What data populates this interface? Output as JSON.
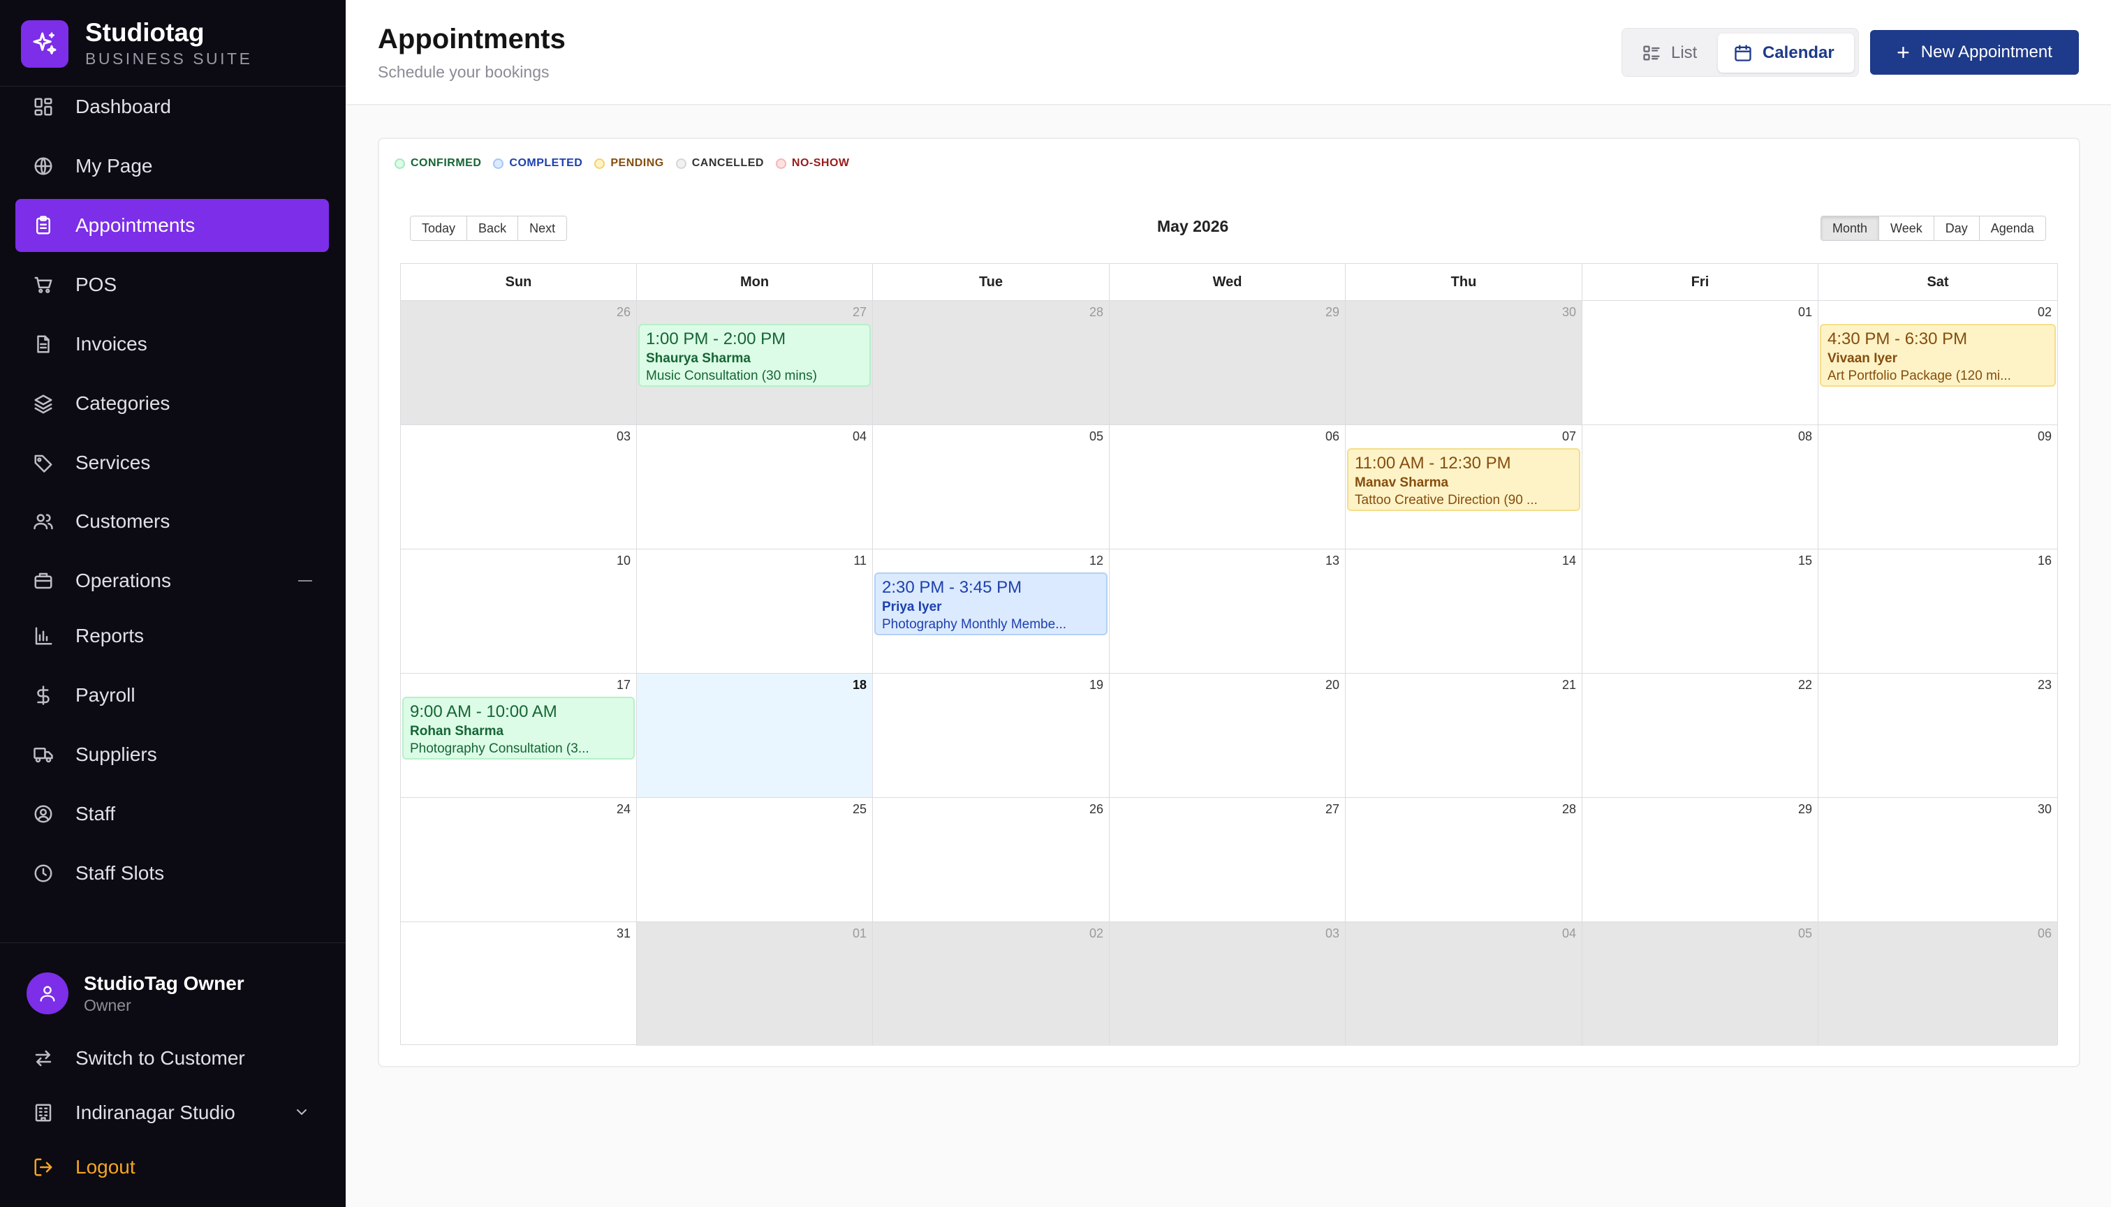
{
  "brand": {
    "name": "Studiotag",
    "subtitle": "BUSINESS SUITE"
  },
  "nav": [
    {
      "label": "Dashboard",
      "icon": "dashboard-icon"
    },
    {
      "label": "My Page",
      "icon": "globe-icon"
    },
    {
      "label": "Appointments",
      "icon": "clipboard-icon",
      "active": true
    },
    {
      "label": "POS",
      "icon": "cart-icon"
    },
    {
      "label": "Invoices",
      "icon": "document-icon"
    },
    {
      "label": "Categories",
      "icon": "layers-icon"
    },
    {
      "label": "Services",
      "icon": "tag-icon"
    },
    {
      "label": "Customers",
      "icon": "users-icon"
    },
    {
      "label": "Operations",
      "icon": "briefcase-icon",
      "expanded": true
    },
    {
      "label": "Reports",
      "icon": "bar-chart-icon"
    },
    {
      "label": "Payroll",
      "icon": "dollar-icon"
    },
    {
      "label": "Suppliers",
      "icon": "truck-icon"
    },
    {
      "label": "Staff",
      "icon": "user-circle-icon"
    },
    {
      "label": "Staff Slots",
      "icon": "clock-icon"
    }
  ],
  "user": {
    "name": "StudioTag Owner",
    "role": "Owner"
  },
  "bottom": {
    "switch_label": "Switch to Customer",
    "studio_label": "Indiranagar Studio",
    "logout_label": "Logout"
  },
  "header": {
    "title": "Appointments",
    "subtitle": "Schedule your bookings",
    "view_list": "List",
    "view_calendar": "Calendar",
    "active_view": "Calendar",
    "new_button": "New Appointment"
  },
  "legend": [
    {
      "label": "CONFIRMED",
      "color": "#166534",
      "dot_fill": "#dcfce7",
      "dot_border": "#a7e8bf"
    },
    {
      "label": "COMPLETED",
      "color": "#1e40af",
      "dot_fill": "#dbeafe",
      "dot_border": "#a8c6f2"
    },
    {
      "label": "PENDING",
      "color": "#854d0e",
      "dot_fill": "#fef3c7",
      "dot_border": "#f2d36e"
    },
    {
      "label": "CANCELLED",
      "color": "#333333",
      "dot_fill": "#f1f1f1",
      "dot_border": "#d6d6d6"
    },
    {
      "label": "NO-SHOW",
      "color": "#991b1b",
      "dot_fill": "#fde2e2",
      "dot_border": "#f3b6b6"
    }
  ],
  "calendar": {
    "nav_buttons": [
      "Today",
      "Back",
      "Next"
    ],
    "month_label": "May 2026",
    "range_buttons": [
      "Month",
      "Week",
      "Day",
      "Agenda"
    ],
    "active_range": "Month",
    "weekdays": [
      "Sun",
      "Mon",
      "Tue",
      "Wed",
      "Thu",
      "Fri",
      "Sat"
    ],
    "weeks": [
      [
        {
          "d": "26",
          "off": true
        },
        {
          "d": "27",
          "off": true
        },
        {
          "d": "28",
          "off": true
        },
        {
          "d": "29",
          "off": true
        },
        {
          "d": "30",
          "off": true
        },
        {
          "d": "01"
        },
        {
          "d": "02"
        }
      ],
      [
        {
          "d": "03"
        },
        {
          "d": "04"
        },
        {
          "d": "05"
        },
        {
          "d": "06"
        },
        {
          "d": "07"
        },
        {
          "d": "08"
        },
        {
          "d": "09"
        }
      ],
      [
        {
          "d": "10"
        },
        {
          "d": "11"
        },
        {
          "d": "12"
        },
        {
          "d": "13"
        },
        {
          "d": "14"
        },
        {
          "d": "15"
        },
        {
          "d": "16"
        }
      ],
      [
        {
          "d": "17"
        },
        {
          "d": "18",
          "today": true
        },
        {
          "d": "19"
        },
        {
          "d": "20"
        },
        {
          "d": "21"
        },
        {
          "d": "22"
        },
        {
          "d": "23"
        }
      ],
      [
        {
          "d": "24"
        },
        {
          "d": "25"
        },
        {
          "d": "26"
        },
        {
          "d": "27"
        },
        {
          "d": "28"
        },
        {
          "d": "29"
        },
        {
          "d": "30"
        }
      ],
      [
        {
          "d": "31"
        },
        {
          "d": "01",
          "off": true
        },
        {
          "d": "02",
          "off": true
        },
        {
          "d": "03",
          "off": true
        },
        {
          "d": "04",
          "off": true
        },
        {
          "d": "05",
          "off": true
        },
        {
          "d": "06",
          "off": true
        }
      ]
    ],
    "events": [
      {
        "week": 0,
        "day": 1,
        "status": "confirmed",
        "time": "1:00 PM - 2:00 PM",
        "customer": "Shaurya Sharma",
        "service": "Music Consultation (30 mins)"
      },
      {
        "week": 0,
        "day": 6,
        "status": "pending",
        "time": "4:30 PM - 6:30 PM",
        "customer": "Vivaan Iyer",
        "service": "Art Portfolio Package (120 mi..."
      },
      {
        "week": 1,
        "day": 4,
        "status": "pending",
        "time": "11:00 AM - 12:30 PM",
        "customer": "Manav Sharma",
        "service": "Tattoo Creative Direction (90 ..."
      },
      {
        "week": 2,
        "day": 2,
        "status": "completed",
        "time": "2:30 PM - 3:45 PM",
        "customer": "Priya Iyer",
        "service": "Photography Monthly Membe..."
      },
      {
        "week": 3,
        "day": 0,
        "status": "confirmed",
        "time": "9:00 AM - 10:00 AM",
        "customer": "Rohan Sharma",
        "service": "Photography Consultation (3..."
      }
    ]
  }
}
